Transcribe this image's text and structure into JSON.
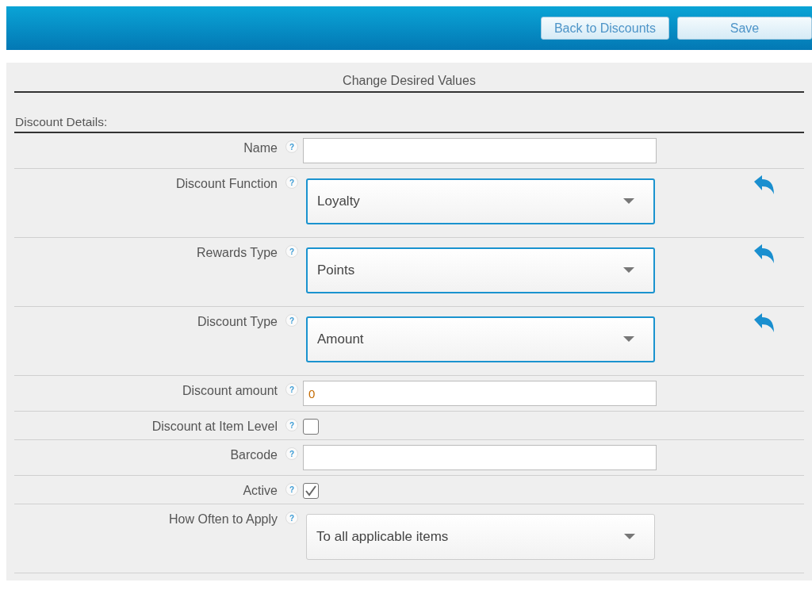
{
  "toolbar": {
    "buttons": [
      "Back to Discounts",
      "Save"
    ]
  },
  "form": {
    "title": "Change Desired Values",
    "section": "Discount Details:",
    "fields": [
      {
        "kind": "text",
        "label": "Name",
        "help": "?"
      },
      {
        "kind": "select",
        "label": "Discount Function",
        "help": "?",
        "value": "Loyalty",
        "changed": true
      },
      {
        "kind": "select",
        "label": "Rewards Type",
        "help": "?",
        "value": "Points",
        "changed": true
      },
      {
        "kind": "select",
        "label": "Discount Type",
        "help": "?",
        "value": "Amount",
        "changed": true
      },
      {
        "kind": "text",
        "label": "Discount amount",
        "help": "?",
        "value": "0"
      },
      {
        "kind": "checkbox",
        "label": "Discount at Item Level",
        "help": "?",
        "checked": false
      },
      {
        "kind": "text",
        "label": "Barcode",
        "help": "?"
      },
      {
        "kind": "checkbox",
        "label": "Active",
        "help": "?",
        "checked": true
      },
      {
        "kind": "select",
        "label": "How Often to Apply",
        "help": "?",
        "value": "To all applicable items",
        "changed": false
      }
    ]
  }
}
